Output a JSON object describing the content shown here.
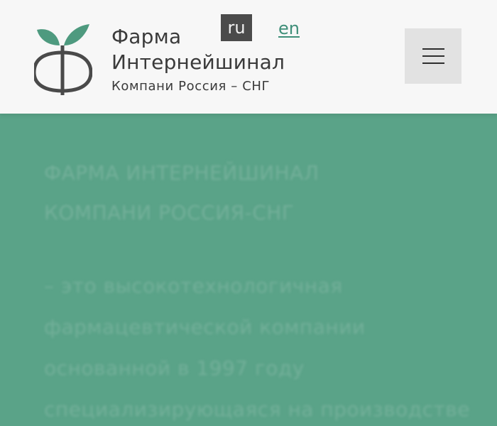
{
  "header": {
    "brand_line1": "Фарма",
    "brand_line2": "Интернейшинал",
    "brand_sub": "Компани Россия – СНГ",
    "lang_ru": "ru",
    "lang_en": "en",
    "menu_icon": "hamburger-icon",
    "logo_icon": "phi-leaf-logo-icon"
  },
  "content": {
    "heading_line1": "ФАРМА ИНТЕРНЕЙШИНАЛ",
    "heading_line2": "КОМПАНИ РОССИЯ-СНГ",
    "para_line1": "– это высокотехнологичная",
    "para_line2": "фармацевтической компании",
    "para_line3": "основанной в 1997 году",
    "para_line4": "специализирующаяся на производстве"
  },
  "colors": {
    "accent_green": "#5aa388",
    "header_bg": "#f7f7f7",
    "lang_active_bg": "#4b4b4b",
    "link_green": "#3f8f79",
    "menu_bg": "#e2e2e2"
  }
}
